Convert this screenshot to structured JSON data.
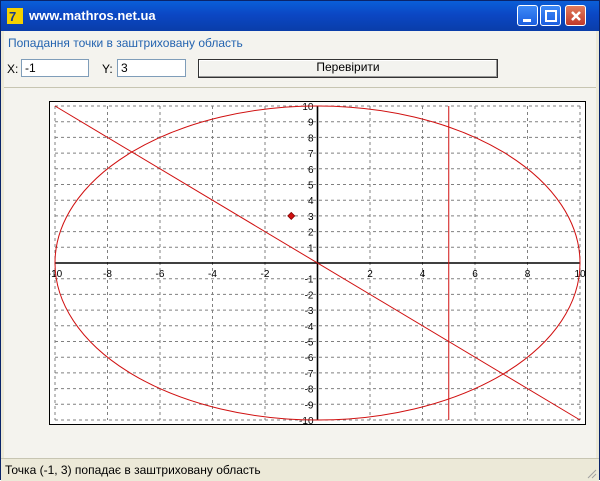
{
  "window": {
    "title": "www.mathros.net.ua",
    "app_icon": "7-logo-icon",
    "controls": [
      "minimize-icon",
      "maximize-icon",
      "close-icon"
    ]
  },
  "header": {
    "subtitle": "Попадання точки в заштриховану область"
  },
  "form": {
    "x_label": "X:",
    "x_value": "-1",
    "y_label": "Y:",
    "y_value": "3",
    "check_button": "Перевірити"
  },
  "status": {
    "text": "Точка (-1, 3) попадає в заштриховану область"
  },
  "colors": {
    "curve": "#d01010",
    "point": "#d01010",
    "grid": "#808080",
    "axis": "#000000"
  },
  "chart_data": {
    "type": "line",
    "xlim": [
      -10,
      10
    ],
    "ylim": [
      -10,
      10
    ],
    "grid": true,
    "x_ticks": [
      -10,
      -8,
      -6,
      -4,
      -2,
      0,
      2,
      4,
      6,
      8,
      10
    ],
    "y_ticks": [
      10,
      9,
      8,
      7,
      6,
      5,
      4,
      3,
      2,
      1,
      0,
      -1,
      -2,
      -3,
      -4,
      -5,
      -6,
      -7,
      -8,
      -9,
      -10
    ],
    "curves": [
      {
        "kind": "ellipse",
        "cx": 0,
        "cy": 0,
        "rx": 10,
        "ry": 10
      },
      {
        "kind": "line",
        "points": [
          [
            -10,
            10
          ],
          [
            10,
            -10
          ]
        ]
      },
      {
        "kind": "vline",
        "x": 5,
        "y_range": [
          -10,
          10
        ]
      }
    ],
    "point": {
      "x": -1,
      "y": 3
    }
  }
}
